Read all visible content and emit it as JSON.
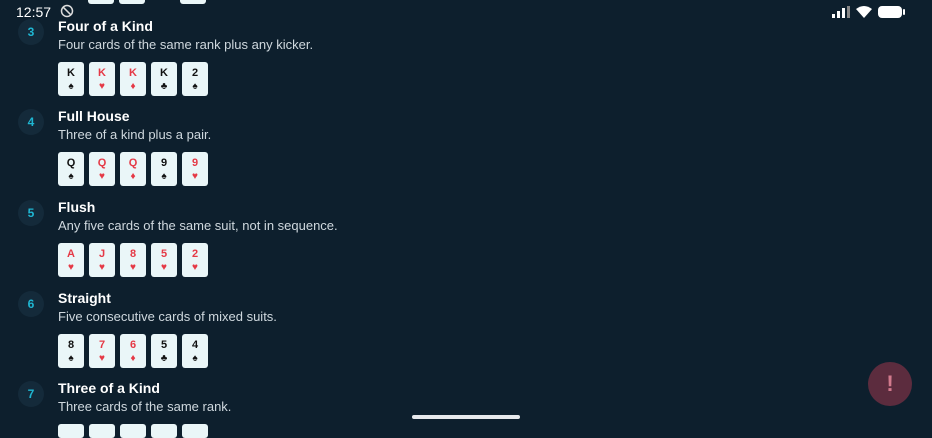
{
  "status": {
    "time": "12:57"
  },
  "hands": [
    {
      "number": "3",
      "title": "Four of a Kind",
      "description": "Four cards of the same rank plus any kicker.",
      "cards": [
        {
          "rank": "K",
          "suit": "♠",
          "color": "black"
        },
        {
          "rank": "K",
          "suit": "♥",
          "color": "red"
        },
        {
          "rank": "K",
          "suit": "♦",
          "color": "red"
        },
        {
          "rank": "K",
          "suit": "♣",
          "color": "black"
        },
        {
          "rank": "2",
          "suit": "♠",
          "color": "black"
        }
      ]
    },
    {
      "number": "4",
      "title": "Full House",
      "description": "Three of a kind plus a pair.",
      "cards": [
        {
          "rank": "Q",
          "suit": "♠",
          "color": "black"
        },
        {
          "rank": "Q",
          "suit": "♥",
          "color": "red"
        },
        {
          "rank": "Q",
          "suit": "♦",
          "color": "red"
        },
        {
          "rank": "9",
          "suit": "♠",
          "color": "black"
        },
        {
          "rank": "9",
          "suit": "♥",
          "color": "red"
        }
      ]
    },
    {
      "number": "5",
      "title": "Flush",
      "description": "Any five cards of the same suit, not in sequence.",
      "cards": [
        {
          "rank": "A",
          "suit": "♥",
          "color": "red"
        },
        {
          "rank": "J",
          "suit": "♥",
          "color": "red"
        },
        {
          "rank": "8",
          "suit": "♥",
          "color": "red"
        },
        {
          "rank": "5",
          "suit": "♥",
          "color": "red"
        },
        {
          "rank": "2",
          "suit": "♥",
          "color": "red"
        }
      ]
    },
    {
      "number": "6",
      "title": "Straight",
      "description": "Five consecutive cards of mixed suits.",
      "cards": [
        {
          "rank": "8",
          "suit": "♠",
          "color": "black"
        },
        {
          "rank": "7",
          "suit": "♥",
          "color": "red"
        },
        {
          "rank": "6",
          "suit": "♦",
          "color": "red"
        },
        {
          "rank": "5",
          "suit": "♣",
          "color": "black"
        },
        {
          "rank": "4",
          "suit": "♠",
          "color": "black"
        }
      ]
    },
    {
      "number": "7",
      "title": "Three of a Kind",
      "description": "Three cards of the same rank.",
      "cards": []
    }
  ],
  "fab": {
    "label": "!",
    "icon": "alert-icon"
  },
  "colors": {
    "background": "#0d1f2d",
    "accent": "#1fb6d2",
    "red_suit": "#e53946",
    "fab": "#5c2c3e"
  }
}
